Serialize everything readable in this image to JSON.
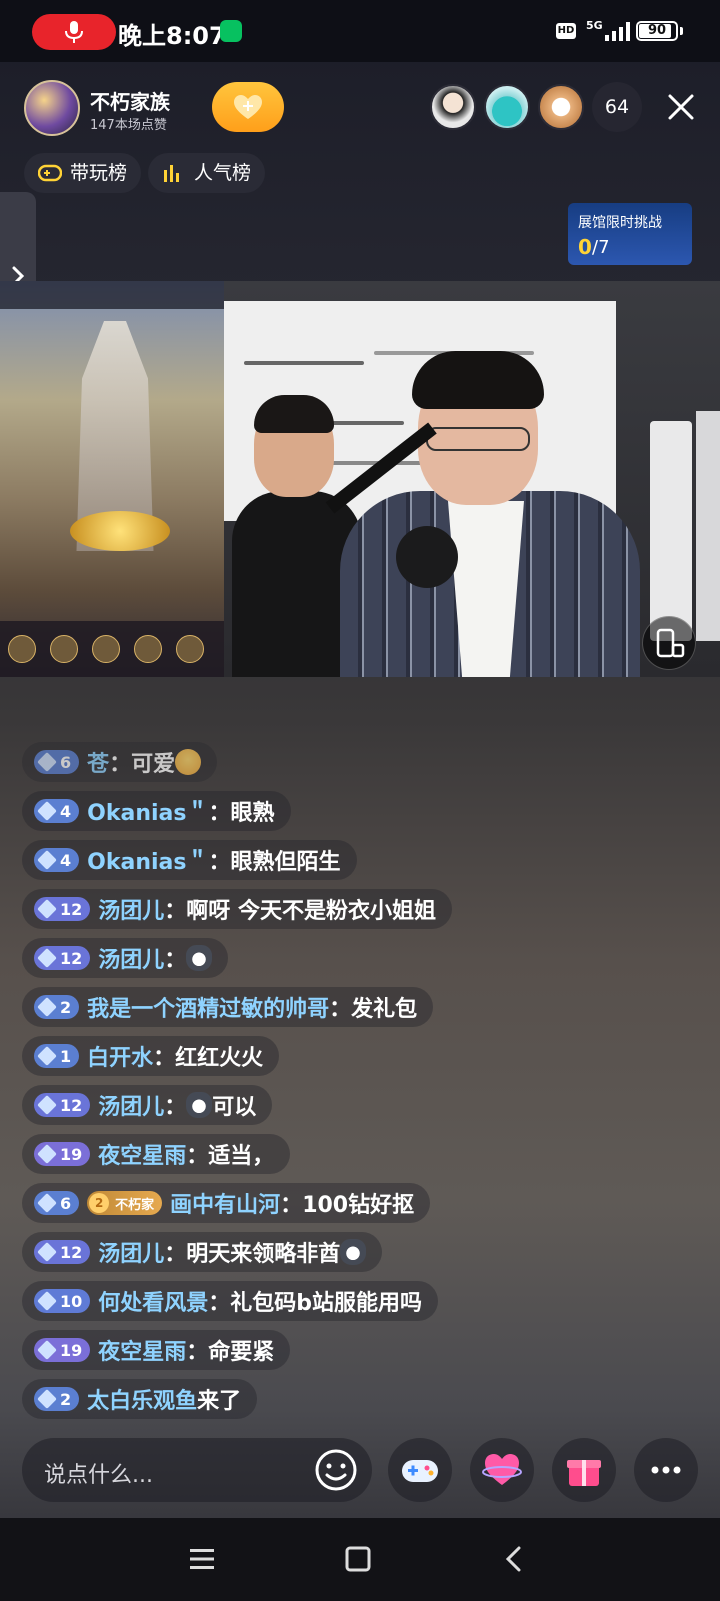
{
  "status_bar": {
    "time": "晚上8:07",
    "network": "5G",
    "hd_label": "HD",
    "battery": "90",
    "battery_level": 0.9
  },
  "header": {
    "anchor_name": "不朽家族",
    "anchor_likes": "147本场点赞",
    "viewer_count": "64",
    "rank_tabs": [
      {
        "label": "带玩榜",
        "icon": "gamepad-icon"
      },
      {
        "label": "人气榜",
        "icon": "bar-chart-icon"
      }
    ],
    "challenge": {
      "title": "展馆限时挑战",
      "count": "0",
      "total": "/7"
    }
  },
  "chat": {
    "messages": [
      {
        "level": "6",
        "user": "苍",
        "text": "可爱",
        "emoji": "smile"
      },
      {
        "level": "4",
        "user": "Okanias＂",
        "text": "眼熟"
      },
      {
        "level": "4",
        "user": "Okanias＂",
        "text": "眼熟但陌生"
      },
      {
        "level": "12",
        "user": "汤团儿",
        "text": "啊呀 今天不是粉衣小姐姐"
      },
      {
        "level": "12",
        "user": "汤团儿",
        "text": "",
        "emoji": "cat"
      },
      {
        "level": "2",
        "user": "我是一个酒精过敏的帅哥",
        "text": "发礼包"
      },
      {
        "level": "1",
        "user": "白开水",
        "text": "红红火火"
      },
      {
        "level": "12",
        "user": "汤团儿",
        "text": "可以",
        "emoji": "cat"
      },
      {
        "level": "19",
        "user": "夜空星雨",
        "text": "适当，"
      },
      {
        "level": "6",
        "fan_badge_level": "2",
        "fan_badge_name": "不朽家",
        "user": "画中有山河",
        "text": "100钻好抠"
      },
      {
        "level": "12",
        "user": "汤团儿",
        "text": "明天来领略非酋",
        "emoji_after": "cat"
      },
      {
        "level": "10",
        "user": "何处看风景",
        "text": "礼包码b站服能用吗"
      },
      {
        "level": "19",
        "user": "夜空星雨",
        "text": "命要紧"
      },
      {
        "level": "2",
        "user": "太白乐观鱼",
        "text": "来了",
        "no_colon": true
      }
    ],
    "badge_colors": {
      "1": "#5b7fd1",
      "2": "#5b7fd1",
      "4": "#5b7fd1",
      "6": "#5b7fd1",
      "10": "#5f7bd6",
      "12": "#6a74d8",
      "19": "#7b6fd8"
    }
  },
  "bottom_bar": {
    "input_placeholder": "说点什么...",
    "buttons": [
      "emoji-icon",
      "game-controller-icon",
      "heart-icon",
      "gift-icon",
      "more-icon"
    ]
  },
  "colors": {
    "accent_follow": "#ffb12b",
    "username": "#8fd3ff",
    "challenge_count": "#ffd336",
    "mic_pill": "#e8242b"
  }
}
